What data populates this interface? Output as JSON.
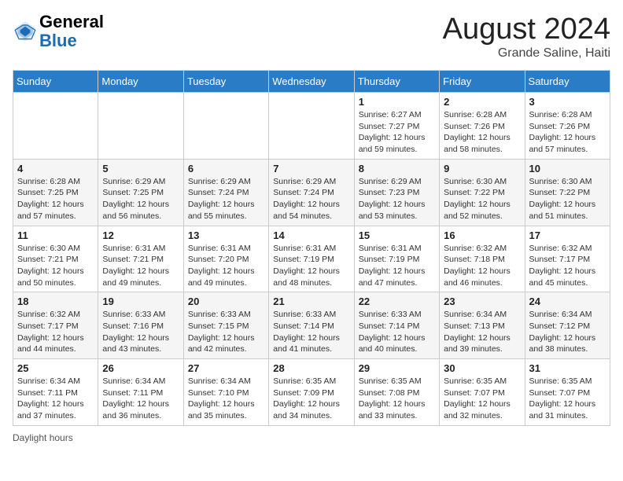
{
  "header": {
    "logo_general": "General",
    "logo_blue": "Blue",
    "month_year": "August 2024",
    "location": "Grande Saline, Haiti"
  },
  "footer": {
    "daylight_label": "Daylight hours"
  },
  "days_of_week": [
    "Sunday",
    "Monday",
    "Tuesday",
    "Wednesday",
    "Thursday",
    "Friday",
    "Saturday"
  ],
  "weeks": [
    {
      "days": [
        {
          "num": "",
          "info": ""
        },
        {
          "num": "",
          "info": ""
        },
        {
          "num": "",
          "info": ""
        },
        {
          "num": "",
          "info": ""
        },
        {
          "num": "1",
          "info": "Sunrise: 6:27 AM\nSunset: 7:27 PM\nDaylight: 12 hours\nand 59 minutes."
        },
        {
          "num": "2",
          "info": "Sunrise: 6:28 AM\nSunset: 7:26 PM\nDaylight: 12 hours\nand 58 minutes."
        },
        {
          "num": "3",
          "info": "Sunrise: 6:28 AM\nSunset: 7:26 PM\nDaylight: 12 hours\nand 57 minutes."
        }
      ]
    },
    {
      "days": [
        {
          "num": "4",
          "info": "Sunrise: 6:28 AM\nSunset: 7:25 PM\nDaylight: 12 hours\nand 57 minutes."
        },
        {
          "num": "5",
          "info": "Sunrise: 6:29 AM\nSunset: 7:25 PM\nDaylight: 12 hours\nand 56 minutes."
        },
        {
          "num": "6",
          "info": "Sunrise: 6:29 AM\nSunset: 7:24 PM\nDaylight: 12 hours\nand 55 minutes."
        },
        {
          "num": "7",
          "info": "Sunrise: 6:29 AM\nSunset: 7:24 PM\nDaylight: 12 hours\nand 54 minutes."
        },
        {
          "num": "8",
          "info": "Sunrise: 6:29 AM\nSunset: 7:23 PM\nDaylight: 12 hours\nand 53 minutes."
        },
        {
          "num": "9",
          "info": "Sunrise: 6:30 AM\nSunset: 7:22 PM\nDaylight: 12 hours\nand 52 minutes."
        },
        {
          "num": "10",
          "info": "Sunrise: 6:30 AM\nSunset: 7:22 PM\nDaylight: 12 hours\nand 51 minutes."
        }
      ]
    },
    {
      "days": [
        {
          "num": "11",
          "info": "Sunrise: 6:30 AM\nSunset: 7:21 PM\nDaylight: 12 hours\nand 50 minutes."
        },
        {
          "num": "12",
          "info": "Sunrise: 6:31 AM\nSunset: 7:21 PM\nDaylight: 12 hours\nand 49 minutes."
        },
        {
          "num": "13",
          "info": "Sunrise: 6:31 AM\nSunset: 7:20 PM\nDaylight: 12 hours\nand 49 minutes."
        },
        {
          "num": "14",
          "info": "Sunrise: 6:31 AM\nSunset: 7:19 PM\nDaylight: 12 hours\nand 48 minutes."
        },
        {
          "num": "15",
          "info": "Sunrise: 6:31 AM\nSunset: 7:19 PM\nDaylight: 12 hours\nand 47 minutes."
        },
        {
          "num": "16",
          "info": "Sunrise: 6:32 AM\nSunset: 7:18 PM\nDaylight: 12 hours\nand 46 minutes."
        },
        {
          "num": "17",
          "info": "Sunrise: 6:32 AM\nSunset: 7:17 PM\nDaylight: 12 hours\nand 45 minutes."
        }
      ]
    },
    {
      "days": [
        {
          "num": "18",
          "info": "Sunrise: 6:32 AM\nSunset: 7:17 PM\nDaylight: 12 hours\nand 44 minutes."
        },
        {
          "num": "19",
          "info": "Sunrise: 6:33 AM\nSunset: 7:16 PM\nDaylight: 12 hours\nand 43 minutes."
        },
        {
          "num": "20",
          "info": "Sunrise: 6:33 AM\nSunset: 7:15 PM\nDaylight: 12 hours\nand 42 minutes."
        },
        {
          "num": "21",
          "info": "Sunrise: 6:33 AM\nSunset: 7:14 PM\nDaylight: 12 hours\nand 41 minutes."
        },
        {
          "num": "22",
          "info": "Sunrise: 6:33 AM\nSunset: 7:14 PM\nDaylight: 12 hours\nand 40 minutes."
        },
        {
          "num": "23",
          "info": "Sunrise: 6:34 AM\nSunset: 7:13 PM\nDaylight: 12 hours\nand 39 minutes."
        },
        {
          "num": "24",
          "info": "Sunrise: 6:34 AM\nSunset: 7:12 PM\nDaylight: 12 hours\nand 38 minutes."
        }
      ]
    },
    {
      "days": [
        {
          "num": "25",
          "info": "Sunrise: 6:34 AM\nSunset: 7:11 PM\nDaylight: 12 hours\nand 37 minutes."
        },
        {
          "num": "26",
          "info": "Sunrise: 6:34 AM\nSunset: 7:11 PM\nDaylight: 12 hours\nand 36 minutes."
        },
        {
          "num": "27",
          "info": "Sunrise: 6:34 AM\nSunset: 7:10 PM\nDaylight: 12 hours\nand 35 minutes."
        },
        {
          "num": "28",
          "info": "Sunrise: 6:35 AM\nSunset: 7:09 PM\nDaylight: 12 hours\nand 34 minutes."
        },
        {
          "num": "29",
          "info": "Sunrise: 6:35 AM\nSunset: 7:08 PM\nDaylight: 12 hours\nand 33 minutes."
        },
        {
          "num": "30",
          "info": "Sunrise: 6:35 AM\nSunset: 7:07 PM\nDaylight: 12 hours\nand 32 minutes."
        },
        {
          "num": "31",
          "info": "Sunrise: 6:35 AM\nSunset: 7:07 PM\nDaylight: 12 hours\nand 31 minutes."
        }
      ]
    }
  ]
}
